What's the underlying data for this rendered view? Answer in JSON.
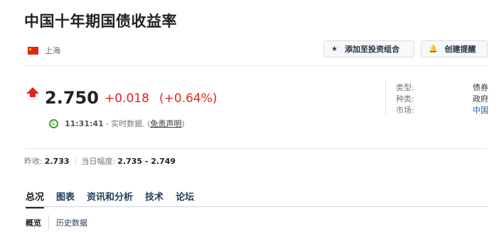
{
  "header": {
    "title": "中国十年期国债收益率"
  },
  "market": {
    "flag_icon": "flag-china-icon",
    "name": "上海"
  },
  "actions": {
    "portfolio_label": "添加至投资组合",
    "portfolio_icon": "star-icon",
    "alert_label": "创建提醒",
    "alert_icon": "bell-icon"
  },
  "quote": {
    "direction_icon": "up-arrow-icon",
    "price": "2.750",
    "change": "+0.018",
    "change_pct": "(+0.64%)",
    "time": "11:31:41",
    "time_suffix": "- 实时数据. (",
    "disclaimer": "免责声明",
    "close_paren": ")"
  },
  "info": [
    {
      "key": "类型:",
      "value": "债券"
    },
    {
      "key": "种类:",
      "value": "政府"
    },
    {
      "key": "市场:",
      "value": "中国"
    }
  ],
  "range": {
    "prev_close_label": "昨收:",
    "prev_close": "2.733",
    "day_range_label": "当日幅度:",
    "day_range": "2.735 - 2.749"
  },
  "tabs": [
    {
      "label": "总况"
    },
    {
      "label": "图表"
    },
    {
      "label": "资讯和分析"
    },
    {
      "label": "技术"
    },
    {
      "label": "论坛"
    }
  ],
  "subtabs": [
    {
      "label": "概览"
    },
    {
      "label": "历史数据"
    }
  ],
  "colors": {
    "up": "#e32522",
    "link": "#1f5ea8",
    "clock": "#3aa335"
  }
}
